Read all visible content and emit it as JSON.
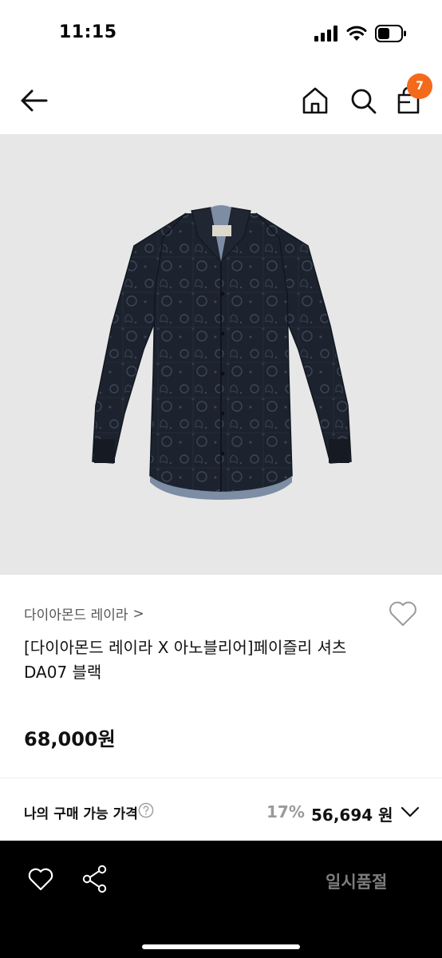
{
  "status_bar": {
    "time": "11:15"
  },
  "nav": {
    "back_icon": "arrow-left-icon",
    "home_icon": "home-icon",
    "search_icon": "search-icon",
    "cart_icon": "cart-icon",
    "cart_count": "7",
    "badge_color": "#f46a1b"
  },
  "product": {
    "image_alt": "black paisley pattern long-sleeve shirt",
    "brand": "다이아몬드 레이라",
    "brand_chevron": ">",
    "name": "[다이아몬드 레이라 X 아노블리어]페이즐리 셔츠 DA07 블랙",
    "price": "68,000원"
  },
  "purchase": {
    "label": "나의 구매 가능 가격",
    "discount": "17%",
    "final_price": "56,694 원"
  },
  "bottom_bar": {
    "heart_icon": "heart-outline-icon",
    "share_icon": "share-icon",
    "status_label": "일시품절"
  }
}
